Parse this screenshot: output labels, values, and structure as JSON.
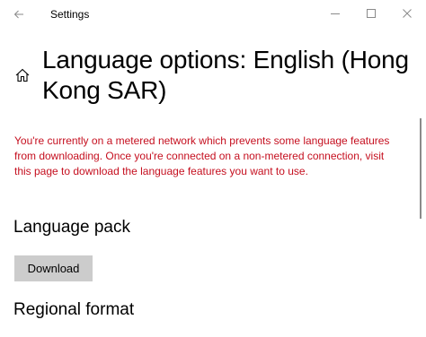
{
  "window": {
    "app_title": "Settings"
  },
  "page": {
    "title": "Language options: English (Hong Kong SAR)"
  },
  "warning": {
    "text": "You're currently on a metered network which prevents some language features from downloading. Once you're connected on a non-metered connection, visit this page to download the language features you want to use."
  },
  "language_pack": {
    "heading": "Language pack",
    "download_label": "Download"
  },
  "regional_format": {
    "heading": "Regional format"
  },
  "icons": {
    "back": "back-arrow-icon",
    "home": "home-icon",
    "minimize": "minimize-icon",
    "maximize": "maximize-icon",
    "close": "close-icon"
  },
  "colors": {
    "warning_text": "#c50f1f",
    "button_bg": "#cccccc",
    "background": "#ffffff"
  }
}
